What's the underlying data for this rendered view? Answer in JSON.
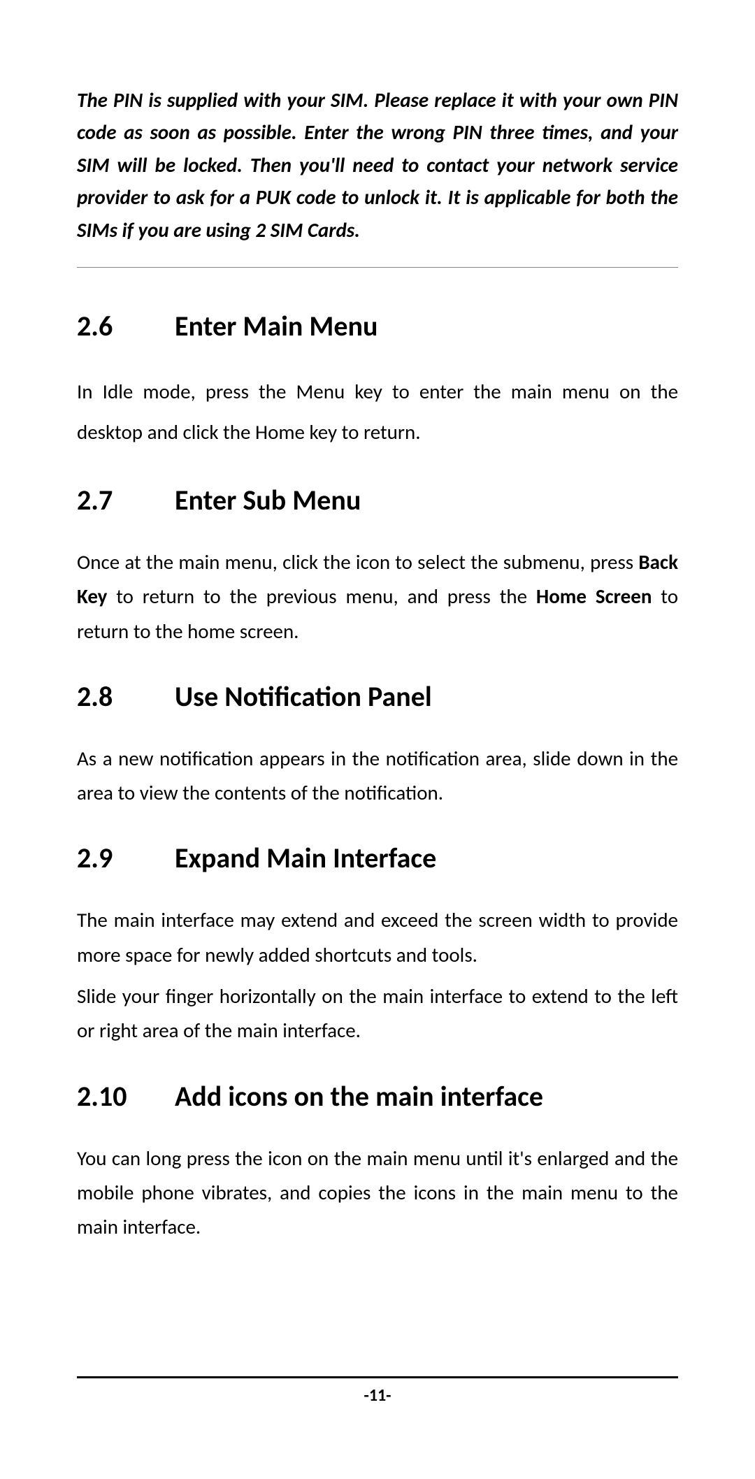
{
  "intro_note": "The PIN is supplied with your SIM. Please replace it with your own PIN code as soon as possible. Enter the wrong PIN three times, and your SIM will be locked. Then you'll need to contact your network service provider to ask for a PUK code to unlock it. It is applicable for both the SIMs if you are using 2 SIM Cards.",
  "sections": {
    "s26": {
      "number": "2.6",
      "title": "Enter Main Menu",
      "body": "In Idle mode, press the Menu key to enter the main menu on the desktop and click the Home key to return."
    },
    "s27": {
      "number": "2.7",
      "title": "Enter Sub Menu",
      "body_pre": "Once at the main menu, click the icon to select the submenu, press ",
      "bold1": "Back Key",
      "body_mid": " to return to the previous menu, and press the ",
      "bold2": "Home Screen",
      "body_post": " to return to the home screen."
    },
    "s28": {
      "number": "2.8",
      "title": "Use Notification Panel",
      "body": "As a new notification appears in the notification area, slide down in the area to view the contents of the notification."
    },
    "s29": {
      "number": "2.9",
      "title": "Expand Main Interface",
      "body_p1": "The main interface may extend and exceed the screen width to provide more space for newly added shortcuts and tools.",
      "body_p2": "Slide your finger horizontally on the main interface to extend to the left or right area of the main interface."
    },
    "s210": {
      "number": "2.10",
      "title": "Add icons on the main interface",
      "body": "You can long press the icon on the main menu until it's enlarged and the mobile phone vibrates, and copies the icons in the main menu to the main interface."
    }
  },
  "page_number": "-11-"
}
